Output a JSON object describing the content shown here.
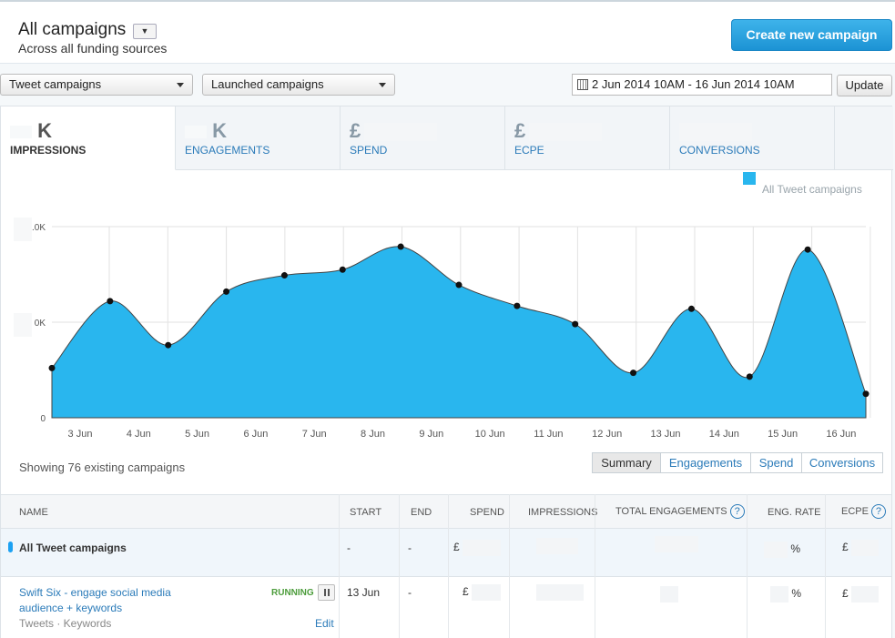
{
  "header": {
    "title": "All campaigns",
    "subtitle": "Across all funding sources",
    "create_button": "Create new campaign"
  },
  "filters": {
    "campaign_type": "Tweet campaigns",
    "status": "Launched campaigns",
    "date_range": "2 Jun 2014 10AM - 16 Jun 2014 10AM",
    "update_button": "Update"
  },
  "metric_tabs": [
    {
      "label": "IMPRESSIONS",
      "value_suffix": "K"
    },
    {
      "label": "ENGAGEMENTS",
      "value_suffix": "K"
    },
    {
      "label": "SPEND",
      "value_prefix": "£"
    },
    {
      "label": "ECPE",
      "value_prefix": "£"
    },
    {
      "label": "CONVERSIONS"
    }
  ],
  "legend": {
    "label": "All Tweet campaigns",
    "color": "#29b6ee"
  },
  "chart_data": {
    "type": "area",
    "y_tick_labels": [
      ".0K",
      "0K",
      "0"
    ],
    "x_tick_labels": [
      "3 Jun",
      "4 Jun",
      "5 Jun",
      "6 Jun",
      "7 Jun",
      "8 Jun",
      "9 Jun",
      "10 Jun",
      "11 Jun",
      "12 Jun",
      "13 Jun",
      "14 Jun",
      "15 Jun",
      "16 Jun"
    ],
    "series": [
      {
        "values": [
          0.52,
          1.22,
          0.76,
          1.32,
          1.49,
          1.55,
          1.79,
          1.39,
          1.17,
          0.98,
          0.47,
          1.14,
          0.43,
          1.76,
          0.25
        ]
      }
    ],
    "ylim": [
      0,
      2
    ],
    "grid": true
  },
  "summary": {
    "showing_text": "Showing 76 existing campaigns",
    "view_tabs": [
      "Summary",
      "Engagements",
      "Spend",
      "Conversions"
    ]
  },
  "table": {
    "headers": {
      "name": "NAME",
      "start": "START",
      "end": "END",
      "spend": "SPEND",
      "impressions": "IMPRESSIONS",
      "total_engagements": "TOTAL ENGAGEMENTS",
      "eng_rate": "ENG. RATE",
      "ecpe": "ECPE"
    },
    "all_row": {
      "name": "All Tweet campaigns",
      "start": "-",
      "end": "-",
      "spend_prefix": "£",
      "eng_rate_suffix": "%",
      "ecpe_prefix": "£"
    },
    "campaign_row": {
      "name": "Swift Six - engage social media audience + keywords",
      "status": "RUNNING",
      "meta": "Tweets · Keywords",
      "edit": "Edit",
      "start": "13 Jun",
      "end": "-",
      "spend_prefix": "£",
      "eng_rate_suffix": "%",
      "ecpe_prefix": "£"
    },
    "help_icon_glyph": "?"
  }
}
